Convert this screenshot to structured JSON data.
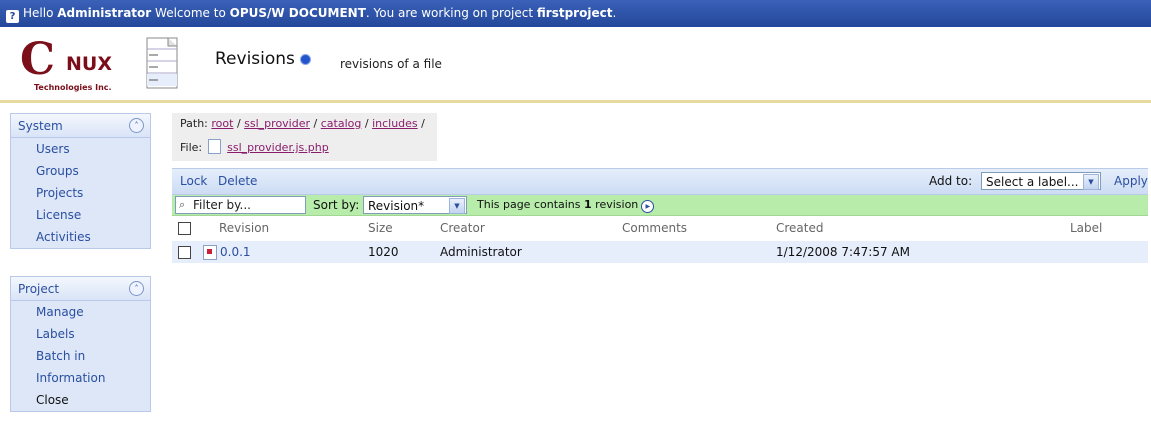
{
  "banner": {
    "hello": "Hello",
    "user": "Administrator",
    "welcome": "Welcome to",
    "app": "OPUS/W DOCUMENT",
    "working": ". You are working on project",
    "project": "firstproject",
    "period": "."
  },
  "logo": {
    "text": "C NUX",
    "letter": "C",
    "rest": "NUX",
    "subtitle": "Technologies Inc."
  },
  "page": {
    "title": "Revisions",
    "subtitle": "revisions of a file"
  },
  "sidebar": {
    "system": {
      "title": "System",
      "items": [
        "Users",
        "Groups",
        "Projects",
        "License",
        "Activities"
      ]
    },
    "project": {
      "title": "Project",
      "items": [
        "Manage",
        "Labels",
        "Batch in",
        "Information",
        "Close"
      ]
    }
  },
  "path": {
    "label": "Path:",
    "segments": [
      "root",
      "ssl_provider",
      "catalog",
      "includes"
    ],
    "separator": "/",
    "file_label": "File:",
    "file": "ssl_provider.js.php"
  },
  "toolbar": {
    "lock": "Lock",
    "delete": "Delete",
    "add_to": "Add to:",
    "label_select": "Select a label...",
    "apply": "Apply"
  },
  "filter": {
    "placeholder": "Filter by...",
    "sort_label": "Sort by:",
    "sort_value": "Revision*",
    "page_info_prefix": "This page contains",
    "count": "1",
    "page_info_suffix": "revision"
  },
  "table": {
    "columns": [
      "Revision",
      "Size",
      "Creator",
      "Comments",
      "Created",
      "Label"
    ],
    "rows": [
      {
        "revision": "0.0.1",
        "size": "1020",
        "creator": "Administrator",
        "comments": "",
        "created": "1/12/2008 7:47:57 AM",
        "label": ""
      }
    ]
  },
  "colors": {
    "banner": "#23479a",
    "toolbar": "#cddcf4",
    "filter_bar": "#b7ecaa",
    "link": "#2a4fa0",
    "path_link": "#8a1d6b",
    "brand": "#7a0f1a"
  }
}
